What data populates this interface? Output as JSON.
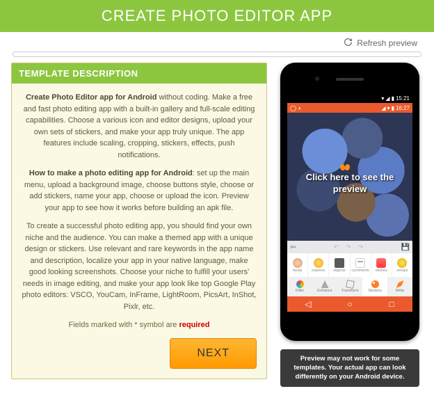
{
  "header": {
    "title": "CREATE PHOTO EDITOR APP"
  },
  "refresh": {
    "label": "Refresh preview"
  },
  "description": {
    "panel_title": "TEMPLATE DESCRIPTION",
    "p1_strong": "Create Photo Editor app for Android",
    "p1_rest": " without coding. Make a free and fast photo editing app with a built-in gallery and full-scale editing capabilities. Choose a various icon and editor designs, upload your own sets of stickers, and make your app truly unique. The app features include scaling, cropping, stickers, effects, push notifications.",
    "p2_strong": "How to make a photo editing app for Android",
    "p2_rest": ": set up the main menu, upload a background image, choose buttons style, choose or add stickers, name your app, choose or upload the icon. Preview your app to see how it works before building an apk file.",
    "p3": "To create a successful photo editing app, you should find your own niche and the audience. You can make a themed app with a unique design or stickers. Use relevant and rare keywords in the app name and description, localize your app in your native language, make good looking screenshots. Choose your niche to fulfill your users' needs in image editing, and make your app look like top Google Play photo editors: VSCO, YouCam, InFrame, LightRoom, PicsArt, InShot, Pixlr, etc.",
    "required_prefix": "Fields marked with * symbol are ",
    "required_word": "required",
    "next_button": "NEXT"
  },
  "preview": {
    "status_time1": "15:21",
    "status_time2": "16:27",
    "click_text": "Click here to see the preview",
    "categories": [
      "facial",
      "express",
      "objects",
      "comments",
      "wishes",
      "emojis"
    ],
    "tools": [
      "Filter",
      "Enhance",
      "Transform",
      "Stickers",
      "Write"
    ],
    "active_tool_index": 3
  },
  "notice": {
    "text": "Preview may not work for some templates. Your actual app can look differently on your Android device."
  }
}
